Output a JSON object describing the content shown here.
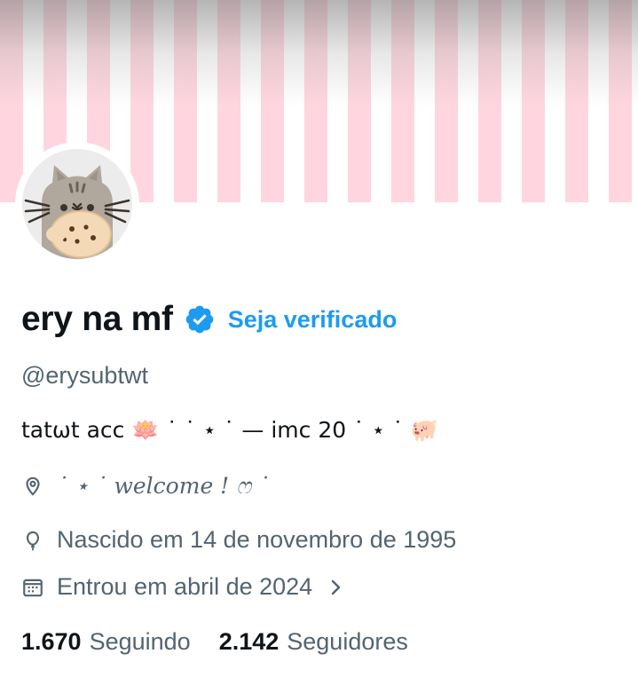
{
  "profile": {
    "display_name": "ery na mf",
    "verify_link": "Seja verificado",
    "handle": "@erysubtwt",
    "bio": "tatωt acc 🪷 ˙ ˙ ⋆ ˙ — imc 20 ˙ ⋆ ˙ 🐖",
    "location": "˙ ⋆ ˙ welcome ! ෆ ˙",
    "birth": "Nascido em 14 de novembro de 1995",
    "joined": "Entrou em abril de 2024",
    "following_count": "1.670",
    "following_label": "Seguindo",
    "followers_count": "2.142",
    "followers_label": "Seguidores"
  },
  "icons": {
    "verified": "verified-badge-icon",
    "location": "location-pin-icon",
    "birth": "balloon-icon",
    "joined": "calendar-icon",
    "chevron": "chevron-right-icon"
  },
  "colors": {
    "accent": "#1d9bf0",
    "text_primary": "#0f1419",
    "text_secondary": "#536471",
    "banner_stripe": "#ffd6df"
  }
}
